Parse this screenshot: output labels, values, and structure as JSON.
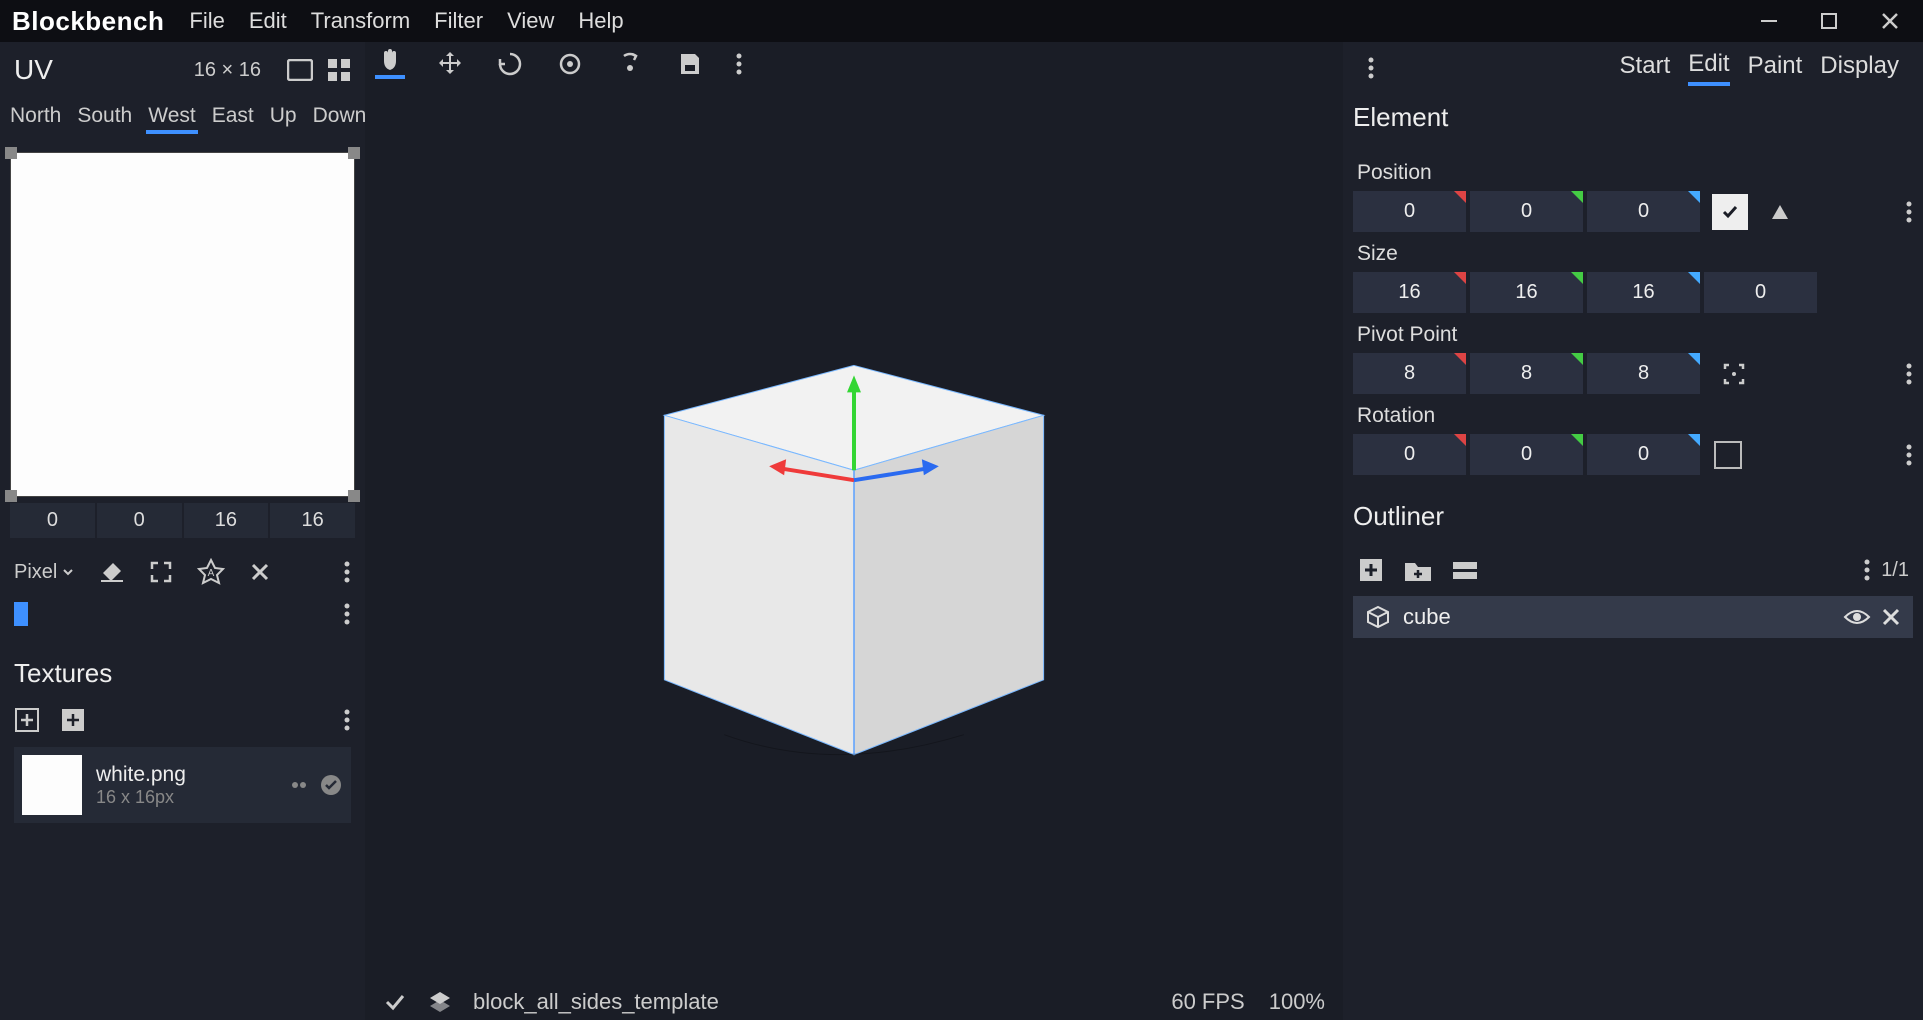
{
  "app": {
    "title": "Blockbench"
  },
  "menu": [
    "File",
    "Edit",
    "Transform",
    "Filter",
    "View",
    "Help"
  ],
  "modes": [
    "Start",
    "Edit",
    "Paint",
    "Display"
  ],
  "active_mode": "Edit",
  "uv": {
    "title": "UV",
    "dims": "16 × 16",
    "faces": [
      "North",
      "South",
      "West",
      "East",
      "Up",
      "Down"
    ],
    "active_face": "West",
    "coords": [
      "0",
      "0",
      "16",
      "16"
    ],
    "brush_mode": "Pixel"
  },
  "textures": {
    "title": "Textures",
    "items": [
      {
        "name": "white.png",
        "dims": "16 x 16px"
      }
    ]
  },
  "status": {
    "project": "block_all_sides_template",
    "fps": "60 FPS",
    "zoom": "100%"
  },
  "element": {
    "title": "Element",
    "position": {
      "label": "Position",
      "x": "0",
      "y": "0",
      "z": "0",
      "locked": true
    },
    "size": {
      "label": "Size",
      "x": "16",
      "y": "16",
      "z": "16",
      "inflate": "0"
    },
    "pivot": {
      "label": "Pivot Point",
      "x": "8",
      "y": "8",
      "z": "8"
    },
    "rotation": {
      "label": "Rotation",
      "x": "0",
      "y": "0",
      "z": "0",
      "rescale": false
    }
  },
  "outliner": {
    "title": "Outliner",
    "count": "1/1",
    "items": [
      {
        "name": "cube",
        "visible": true
      }
    ]
  },
  "colors": {
    "accent": "#3e90ff",
    "axis_x": "#ef3a3a",
    "axis_y": "#33d633",
    "axis_z": "#2a6af0"
  }
}
